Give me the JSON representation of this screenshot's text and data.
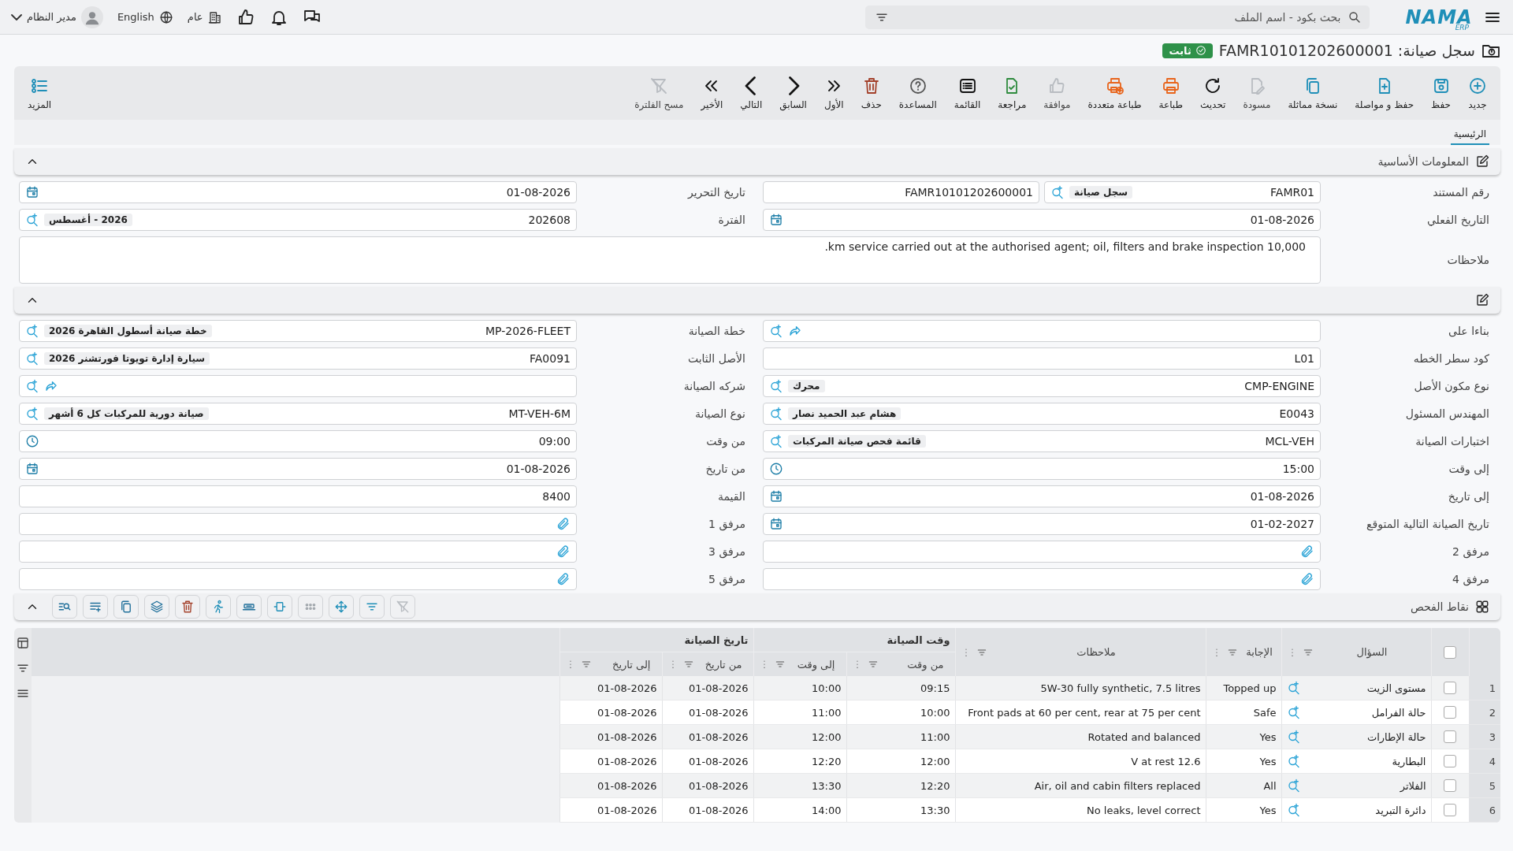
{
  "topbar": {
    "logo": "NAMA",
    "logo_sub": "ERP",
    "search_placeholder": "بحث بكود - اسم الملف",
    "branch": "عام",
    "language": "English",
    "user": "مدير النظام"
  },
  "document": {
    "title": "سجل صيانة:",
    "code": "FAMR10101202600001",
    "status": "ثابت"
  },
  "toolbar": [
    {
      "kind": "new",
      "label": "جديد",
      "disabled": false
    },
    {
      "kind": "save",
      "label": "حفظ",
      "disabled": false
    },
    {
      "kind": "save-continue",
      "label": "حفظ و مواصلة",
      "disabled": false
    },
    {
      "kind": "duplicate",
      "label": "نسخة مماثلة",
      "disabled": false
    },
    {
      "kind": "draft",
      "label": "مسودة",
      "disabled": true
    },
    {
      "kind": "refresh",
      "label": "تحديث",
      "disabled": false
    },
    {
      "kind": "print",
      "label": "طباعة",
      "disabled": false
    },
    {
      "kind": "multi-print",
      "label": "طباعة متعددة",
      "disabled": false
    },
    {
      "kind": "approve",
      "label": "موافقة",
      "disabled": true
    },
    {
      "kind": "review",
      "label": "مراجعة",
      "disabled": false
    },
    {
      "kind": "list",
      "label": "القائمة",
      "disabled": false
    },
    {
      "kind": "help",
      "label": "المساعدة",
      "disabled": false
    },
    {
      "kind": "delete",
      "label": "حذف",
      "disabled": false
    },
    {
      "kind": "first",
      "label": "الأول",
      "disabled": false
    },
    {
      "kind": "previous",
      "label": "السابق",
      "disabled": false
    },
    {
      "kind": "next",
      "label": "التالي",
      "disabled": false
    },
    {
      "kind": "last",
      "label": "الأخير",
      "disabled": false
    },
    {
      "kind": "clear-filter",
      "label": "مسح الفلترة",
      "disabled": true
    }
  ],
  "more": "المزيد",
  "tabs": [
    {
      "label": "الرئيسية",
      "selected": true
    }
  ],
  "sections": [
    {
      "title": "المعلومات الأساسية",
      "expanded": true,
      "fields": [
        {
          "kind": "pair",
          "label": "رقم المستند",
          "value": "FAMR01",
          "tag": "سجل صيانة",
          "value2": "FAMR10101202600001"
        },
        {
          "kind": "date",
          "label": "تاريخ التحرير",
          "value": "01-08-2026"
        },
        {
          "kind": "date",
          "label": "التاريخ الفعلي",
          "value": "01-08-2026"
        },
        {
          "kind": "lookup",
          "label": "الفترة",
          "value": "202608",
          "tag": "2026 - أغسطس"
        },
        {
          "kind": "notes",
          "label": "ملاحظات",
          "value": "10,000 km service carried out at the authorised agent; oil, filters and brake inspection."
        }
      ]
    },
    {
      "expanded": true,
      "fields": [
        {
          "kind": "link",
          "label": "بناءا على"
        },
        {
          "kind": "lookup",
          "label": "خطة الصيانة",
          "value": "MP-2026-FLEET",
          "tag": "خطة صيانة أسطول القاهرة 2026"
        },
        {
          "kind": "text",
          "label": "كود سطر الخطه",
          "value": "L01"
        },
        {
          "kind": "lookup",
          "label": "الأصل الثابت",
          "value": "FA0091",
          "tag": "سيارة إدارة تويوتا فورتشنر 2026"
        },
        {
          "kind": "lookup",
          "label": "نوع مكون الأصل",
          "value": "CMP-ENGINE",
          "tag": "محرك"
        },
        {
          "kind": "link",
          "label": "شركه الصيانة"
        },
        {
          "kind": "lookup",
          "label": "المهندس المسئول",
          "value": "E0043",
          "tag": "هشام عبد الحميد نصار"
        },
        {
          "kind": "lookup",
          "label": "نوع الصيانة",
          "value": "MT-VEH-6M",
          "tag": "صيانة دورية للمركبات كل 6 أشهر"
        },
        {
          "kind": "lookup",
          "label": "اختبارات الصيانة",
          "value": "MCL-VEH",
          "tag": "قائمة فحص صيانة المركبات"
        },
        {
          "kind": "time",
          "label": "من وقت",
          "value": "09:00"
        },
        {
          "kind": "time",
          "label": "إلى وقت",
          "value": "15:00"
        },
        {
          "kind": "date",
          "label": "من تاريخ",
          "value": "01-08-2026"
        },
        {
          "kind": "date",
          "label": "إلى تاريخ",
          "value": "01-08-2026"
        },
        {
          "kind": "text",
          "label": "القيمة",
          "value": "8400"
        },
        {
          "kind": "date",
          "label": "تاريخ الصيانة التالية المتوقع",
          "value": "01-02-2027"
        },
        {
          "kind": "attach",
          "label": "مرفق 1"
        },
        {
          "kind": "attach",
          "label": "مرفق 2"
        },
        {
          "kind": "attach",
          "label": "مرفق 3"
        },
        {
          "kind": "attach",
          "label": "مرفق 4"
        },
        {
          "kind": "attach",
          "label": "مرفق 5"
        }
      ]
    }
  ],
  "checkpoints": {
    "title": "نقاط الفحص",
    "expanded": true,
    "tools": [
      {
        "kind": "clear-filter",
        "disabled": true
      },
      {
        "kind": "filter",
        "disabled": false
      },
      {
        "kind": "move",
        "disabled": false
      },
      {
        "kind": "dots",
        "disabled": false
      },
      {
        "kind": "fit",
        "disabled": false
      },
      {
        "kind": "rows",
        "disabled": false
      },
      {
        "kind": "run",
        "disabled": false
      },
      {
        "kind": "delete",
        "disabled": false
      },
      {
        "kind": "layers",
        "disabled": false
      },
      {
        "kind": "copy",
        "disabled": false
      },
      {
        "kind": "add-line",
        "disabled": false
      },
      {
        "kind": "search-list",
        "disabled": false
      }
    ],
    "select_all": {
      "checked": false
    },
    "columns": {
      "question": "السؤال",
      "answer": "الإجابة",
      "notes": "ملاحظات",
      "time_group": "وقت الصيانة",
      "from_time": "من وقت",
      "to_time": "إلى وقت",
      "date_group": "تاريخ الصيانة",
      "from_date": "من تاريخ",
      "to_date": "إلى تاريخ"
    },
    "rows": [
      {
        "number": "1",
        "checked": false,
        "question": "مستوى الزيت",
        "answer": "Topped up",
        "notes": "5W-30 fully synthetic, 7.5 litres",
        "from_time": "09:15",
        "to_time": "10:00",
        "from_date": "01-08-2026",
        "to_date": "01-08-2026"
      },
      {
        "number": "2",
        "checked": false,
        "question": "حالة الفرامل",
        "answer": "Safe",
        "notes": "Front pads at 60 per cent, rear at 75 per cent",
        "from_time": "10:00",
        "to_time": "11:00",
        "from_date": "01-08-2026",
        "to_date": "01-08-2026"
      },
      {
        "number": "3",
        "checked": false,
        "question": "حالة الإطارات",
        "answer": "Yes",
        "notes": "Rotated and balanced",
        "from_time": "11:00",
        "to_time": "12:00",
        "from_date": "01-08-2026",
        "to_date": "01-08-2026"
      },
      {
        "number": "4",
        "checked": false,
        "question": "البطارية",
        "answer": "Yes",
        "notes": "12.6 V at rest",
        "from_time": "12:00",
        "to_time": "12:20",
        "from_date": "01-08-2026",
        "to_date": "01-08-2026"
      },
      {
        "number": "5",
        "checked": false,
        "question": "الفلاتر",
        "answer": "All",
        "notes": "Air, oil and cabin filters replaced",
        "from_time": "12:20",
        "to_time": "13:30",
        "from_date": "01-08-2026",
        "to_date": "01-08-2026"
      },
      {
        "number": "6",
        "checked": false,
        "question": "دائرة التبريد",
        "answer": "Yes",
        "notes": "No leaks, level correct",
        "from_time": "13:30",
        "to_time": "14:00",
        "from_date": "01-08-2026",
        "to_date": "01-08-2026"
      }
    ]
  }
}
